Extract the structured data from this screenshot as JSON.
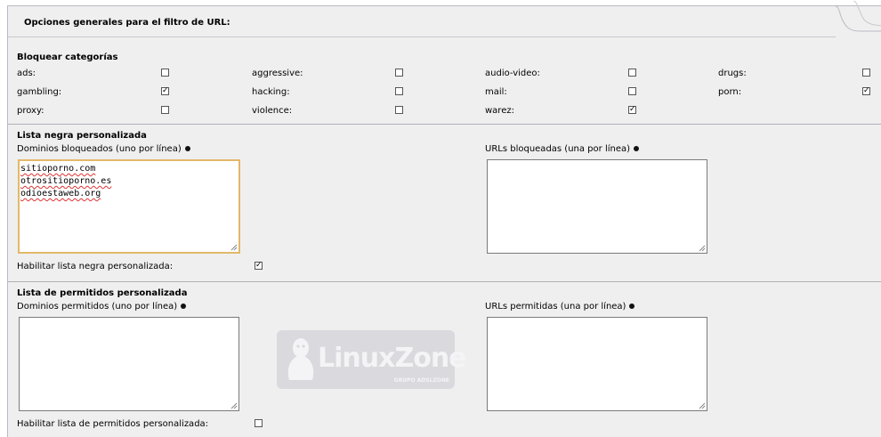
{
  "header": {
    "title": "Opciones generales para el filtro de URL:"
  },
  "block_categories": {
    "title": "Bloquear categorías",
    "items": [
      {
        "label": "ads:",
        "checked": false
      },
      {
        "label": "aggressive:",
        "checked": false
      },
      {
        "label": "audio-video:",
        "checked": false
      },
      {
        "label": "drugs:",
        "checked": false
      },
      {
        "label": "gambling:",
        "checked": true
      },
      {
        "label": "hacking:",
        "checked": false
      },
      {
        "label": "mail:",
        "checked": false
      },
      {
        "label": "porn:",
        "checked": true
      },
      {
        "label": "proxy:",
        "checked": false
      },
      {
        "label": "violence:",
        "checked": false
      },
      {
        "label": "warez:",
        "checked": true
      }
    ]
  },
  "blacklist": {
    "title": "Lista negra personalizada",
    "domains_label": "Dominios bloqueados (uno por línea)",
    "domains_lines": [
      "sitioporno.com",
      "otrositioporno.es",
      "odioestaweb.org"
    ],
    "urls_label": "URLs bloqueadas (una por línea)",
    "enable_label": "Habilitar lista negra personalizada:",
    "enable_checked": true
  },
  "whitelist": {
    "title": "Lista de permitidos personalizada",
    "domains_label": "Dominios permitidos (uno por línea)",
    "urls_label": "URLs permitidas (una por línea)",
    "enable_label": "Habilitar lista de permitidos personalizada:",
    "enable_checked": false
  },
  "watermark": {
    "text": "LinuxZone",
    "sub": "GRUPO ADSLZONE"
  },
  "checkmark_glyph": "✓"
}
